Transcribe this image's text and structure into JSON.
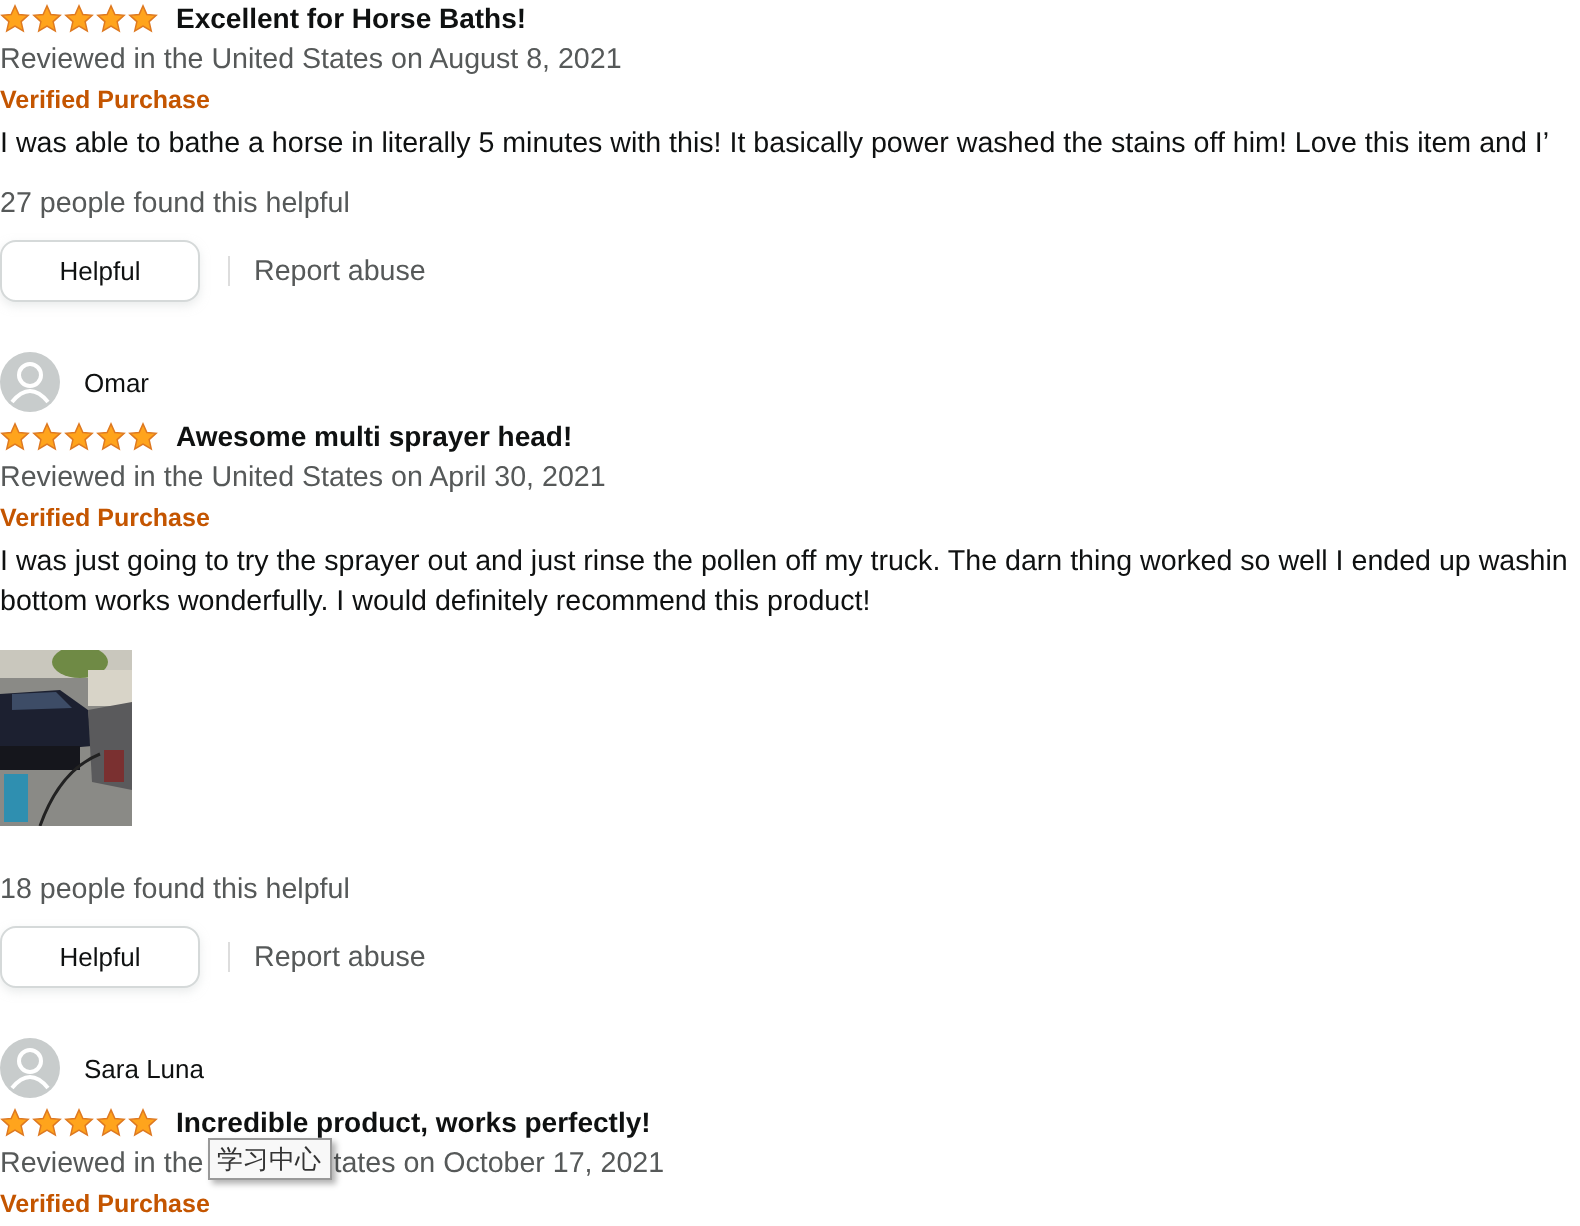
{
  "reviews": [
    {
      "stars": 5,
      "title": "Excellent for Horse Baths!",
      "date": "Reviewed in the United States on August 8, 2021",
      "badge": "Verified Purchase",
      "body": [
        "I was able to bathe a horse in literally 5 minutes with this! It basically power washed the stains off him! Love this item and I’"
      ],
      "helpful_count": "27 people found this helpful",
      "helpful_button": "Helpful",
      "report_link": "Report abuse"
    },
    {
      "reviewer": "Omar",
      "stars": 5,
      "title": "Awesome multi sprayer head!",
      "date": "Reviewed in the United States on April 30, 2021",
      "badge": "Verified Purchase",
      "body": [
        "I was just going to try the sprayer out and just rinse the pollen off my truck. The darn thing worked so well I ended up washin",
        "bottom works wonderfully. I would definitely recommend this product!"
      ],
      "photos": [
        {
          "kind": "picture"
        }
      ],
      "helpful_count": "18 people found this helpful",
      "helpful_button": "Helpful",
      "report_link": "Report abuse"
    },
    {
      "reviewer": "Sara Luna",
      "stars": 5,
      "title": "Incredible product, works perfectly!",
      "date_parts": [
        "Reviewed in the",
        "tates on October 17, 2021"
      ],
      "tooltip": "学习中心",
      "badge": "Verified Purchase"
    }
  ]
}
